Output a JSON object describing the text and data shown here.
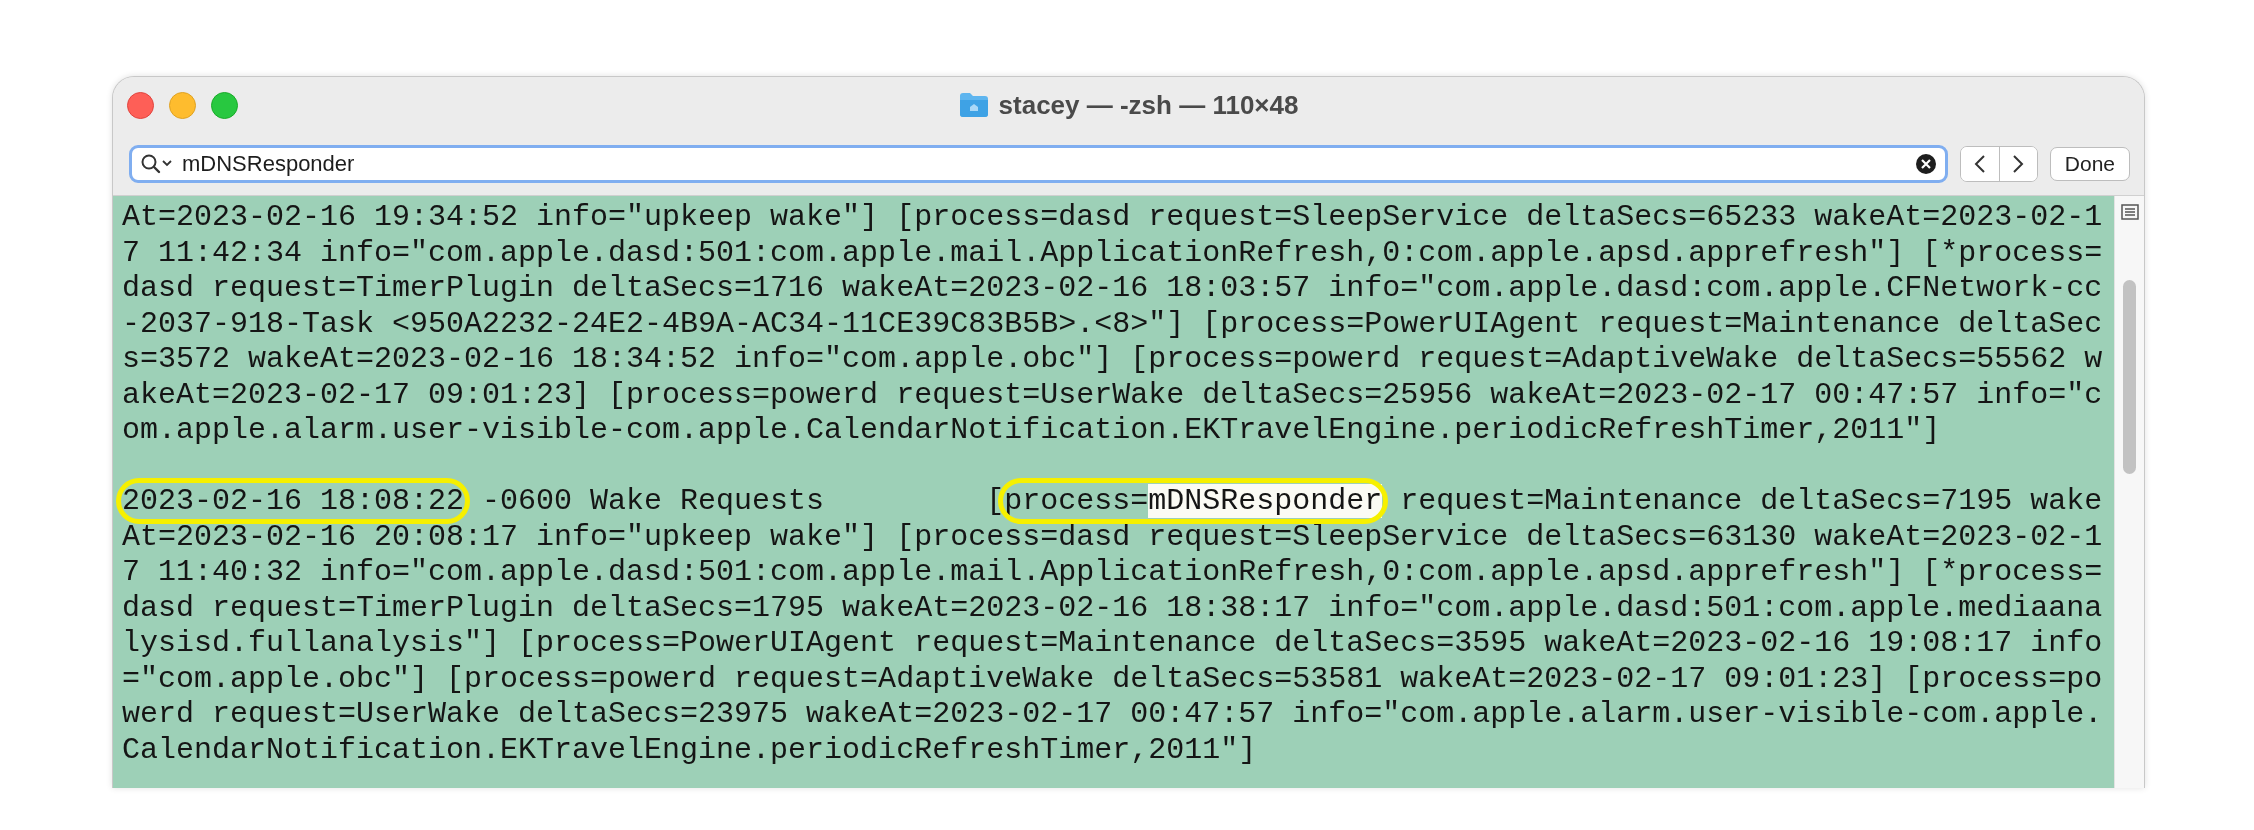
{
  "window": {
    "title": "stacey — -zsh — 110×48"
  },
  "find_bar": {
    "value": "mDNSResponder",
    "done_button": "Done"
  },
  "terminal": {
    "lines": [
      {
        "kind": "text",
        "text": "At=2023-02-16 19:34:52 info=\"upkeep wake\"] [process=dasd request=SleepService deltaSecs=65233 wakeAt=2023-02-1"
      },
      {
        "kind": "text",
        "text": "7 11:42:34 info=\"com.apple.dasd:501:com.apple.mail.ApplicationRefresh,0:com.apple.apsd.apprefresh\"] [*process="
      },
      {
        "kind": "text",
        "text": "dasd request=TimerPlugin deltaSecs=1716 wakeAt=2023-02-16 18:03:57 info=\"com.apple.dasd:com.apple.CFNetwork-cc"
      },
      {
        "kind": "text",
        "text": "-2037-918-Task <950A2232-24E2-4B9A-AC34-11CE39C83B5B>.<8>\"] [process=PowerUIAgent request=Maintenance deltaSec"
      },
      {
        "kind": "text",
        "text": "s=3572 wakeAt=2023-02-16 18:34:52 info=\"com.apple.obc\"] [process=powerd request=AdaptiveWake deltaSecs=55562 w"
      },
      {
        "kind": "text",
        "text": "akeAt=2023-02-17 09:01:23] [process=powerd request=UserWake deltaSecs=25956 wakeAt=2023-02-17 00:47:57 info=\"c"
      },
      {
        "kind": "text",
        "text": "om.apple.alarm.user-visible-com.apple.CalendarNotification.EKTravelEngine.periodicRefreshTimer,2011\"]"
      },
      {
        "kind": "blank"
      },
      {
        "kind": "segmented",
        "segments": [
          {
            "circled": true,
            "parts": [
              {
                "text": "2023-02-16 18:08:22",
                "match": false
              }
            ]
          },
          {
            "circled": false,
            "parts": [
              {
                "text": " -0600 Wake Requests         [",
                "match": false
              }
            ]
          },
          {
            "circled": true,
            "parts": [
              {
                "text": "process=",
                "match": false
              },
              {
                "text": "mDNSResponder",
                "match": true
              }
            ]
          },
          {
            "circled": false,
            "parts": [
              {
                "text": " request=Maintenance deltaSecs=7195 wake",
                "match": false
              }
            ]
          }
        ]
      },
      {
        "kind": "text",
        "text": "At=2023-02-16 20:08:17 info=\"upkeep wake\"] [process=dasd request=SleepService deltaSecs=63130 wakeAt=2023-02-1"
      },
      {
        "kind": "text",
        "text": "7 11:40:32 info=\"com.apple.dasd:501:com.apple.mail.ApplicationRefresh,0:com.apple.apsd.apprefresh\"] [*process="
      },
      {
        "kind": "text",
        "text": "dasd request=TimerPlugin deltaSecs=1795 wakeAt=2023-02-16 18:38:17 info=\"com.apple.dasd:501:com.apple.mediaana"
      },
      {
        "kind": "text",
        "text": "lysisd.fullanalysis\"] [process=PowerUIAgent request=Maintenance deltaSecs=3595 wakeAt=2023-02-16 19:08:17 info"
      },
      {
        "kind": "text",
        "text": "=\"com.apple.obc\"] [process=powerd request=AdaptiveWake deltaSecs=53581 wakeAt=2023-02-17 09:01:23] [process=po"
      },
      {
        "kind": "text",
        "text": "werd request=UserWake deltaSecs=23975 wakeAt=2023-02-17 00:47:57 info=\"com.apple.alarm.user-visible-com.apple."
      },
      {
        "kind": "text",
        "text": "CalendarNotification.EKTravelEngine.periodicRefreshTimer,2011\"]"
      }
    ]
  }
}
